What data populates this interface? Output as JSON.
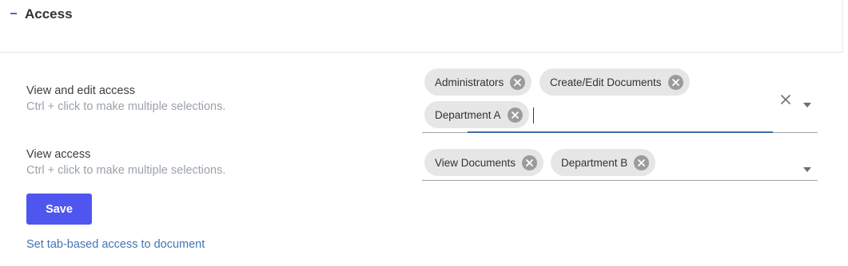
{
  "section": {
    "title": "Access",
    "collapse_icon": "minus-icon"
  },
  "view_edit": {
    "label": "View and edit access",
    "hint": "Ctrl + click to make multiple selections.",
    "chips": [
      "Administrators",
      "Create/Edit Documents",
      "Department A"
    ]
  },
  "view": {
    "label": "View access",
    "hint": "Ctrl + click to make multiple selections.",
    "chips": [
      "View Documents",
      "Department B"
    ]
  },
  "actions": {
    "save_label": "Save",
    "tab_link": "Set tab-based access to document"
  },
  "icons": {
    "chip_remove": "close-circle-icon",
    "clear": "close-icon",
    "dropdown": "caret-down-icon"
  },
  "colors": {
    "accent": "#4f56f0",
    "link": "#4573b4",
    "focus": "#3f6fa8",
    "chip_bg": "#e6e6e6"
  }
}
